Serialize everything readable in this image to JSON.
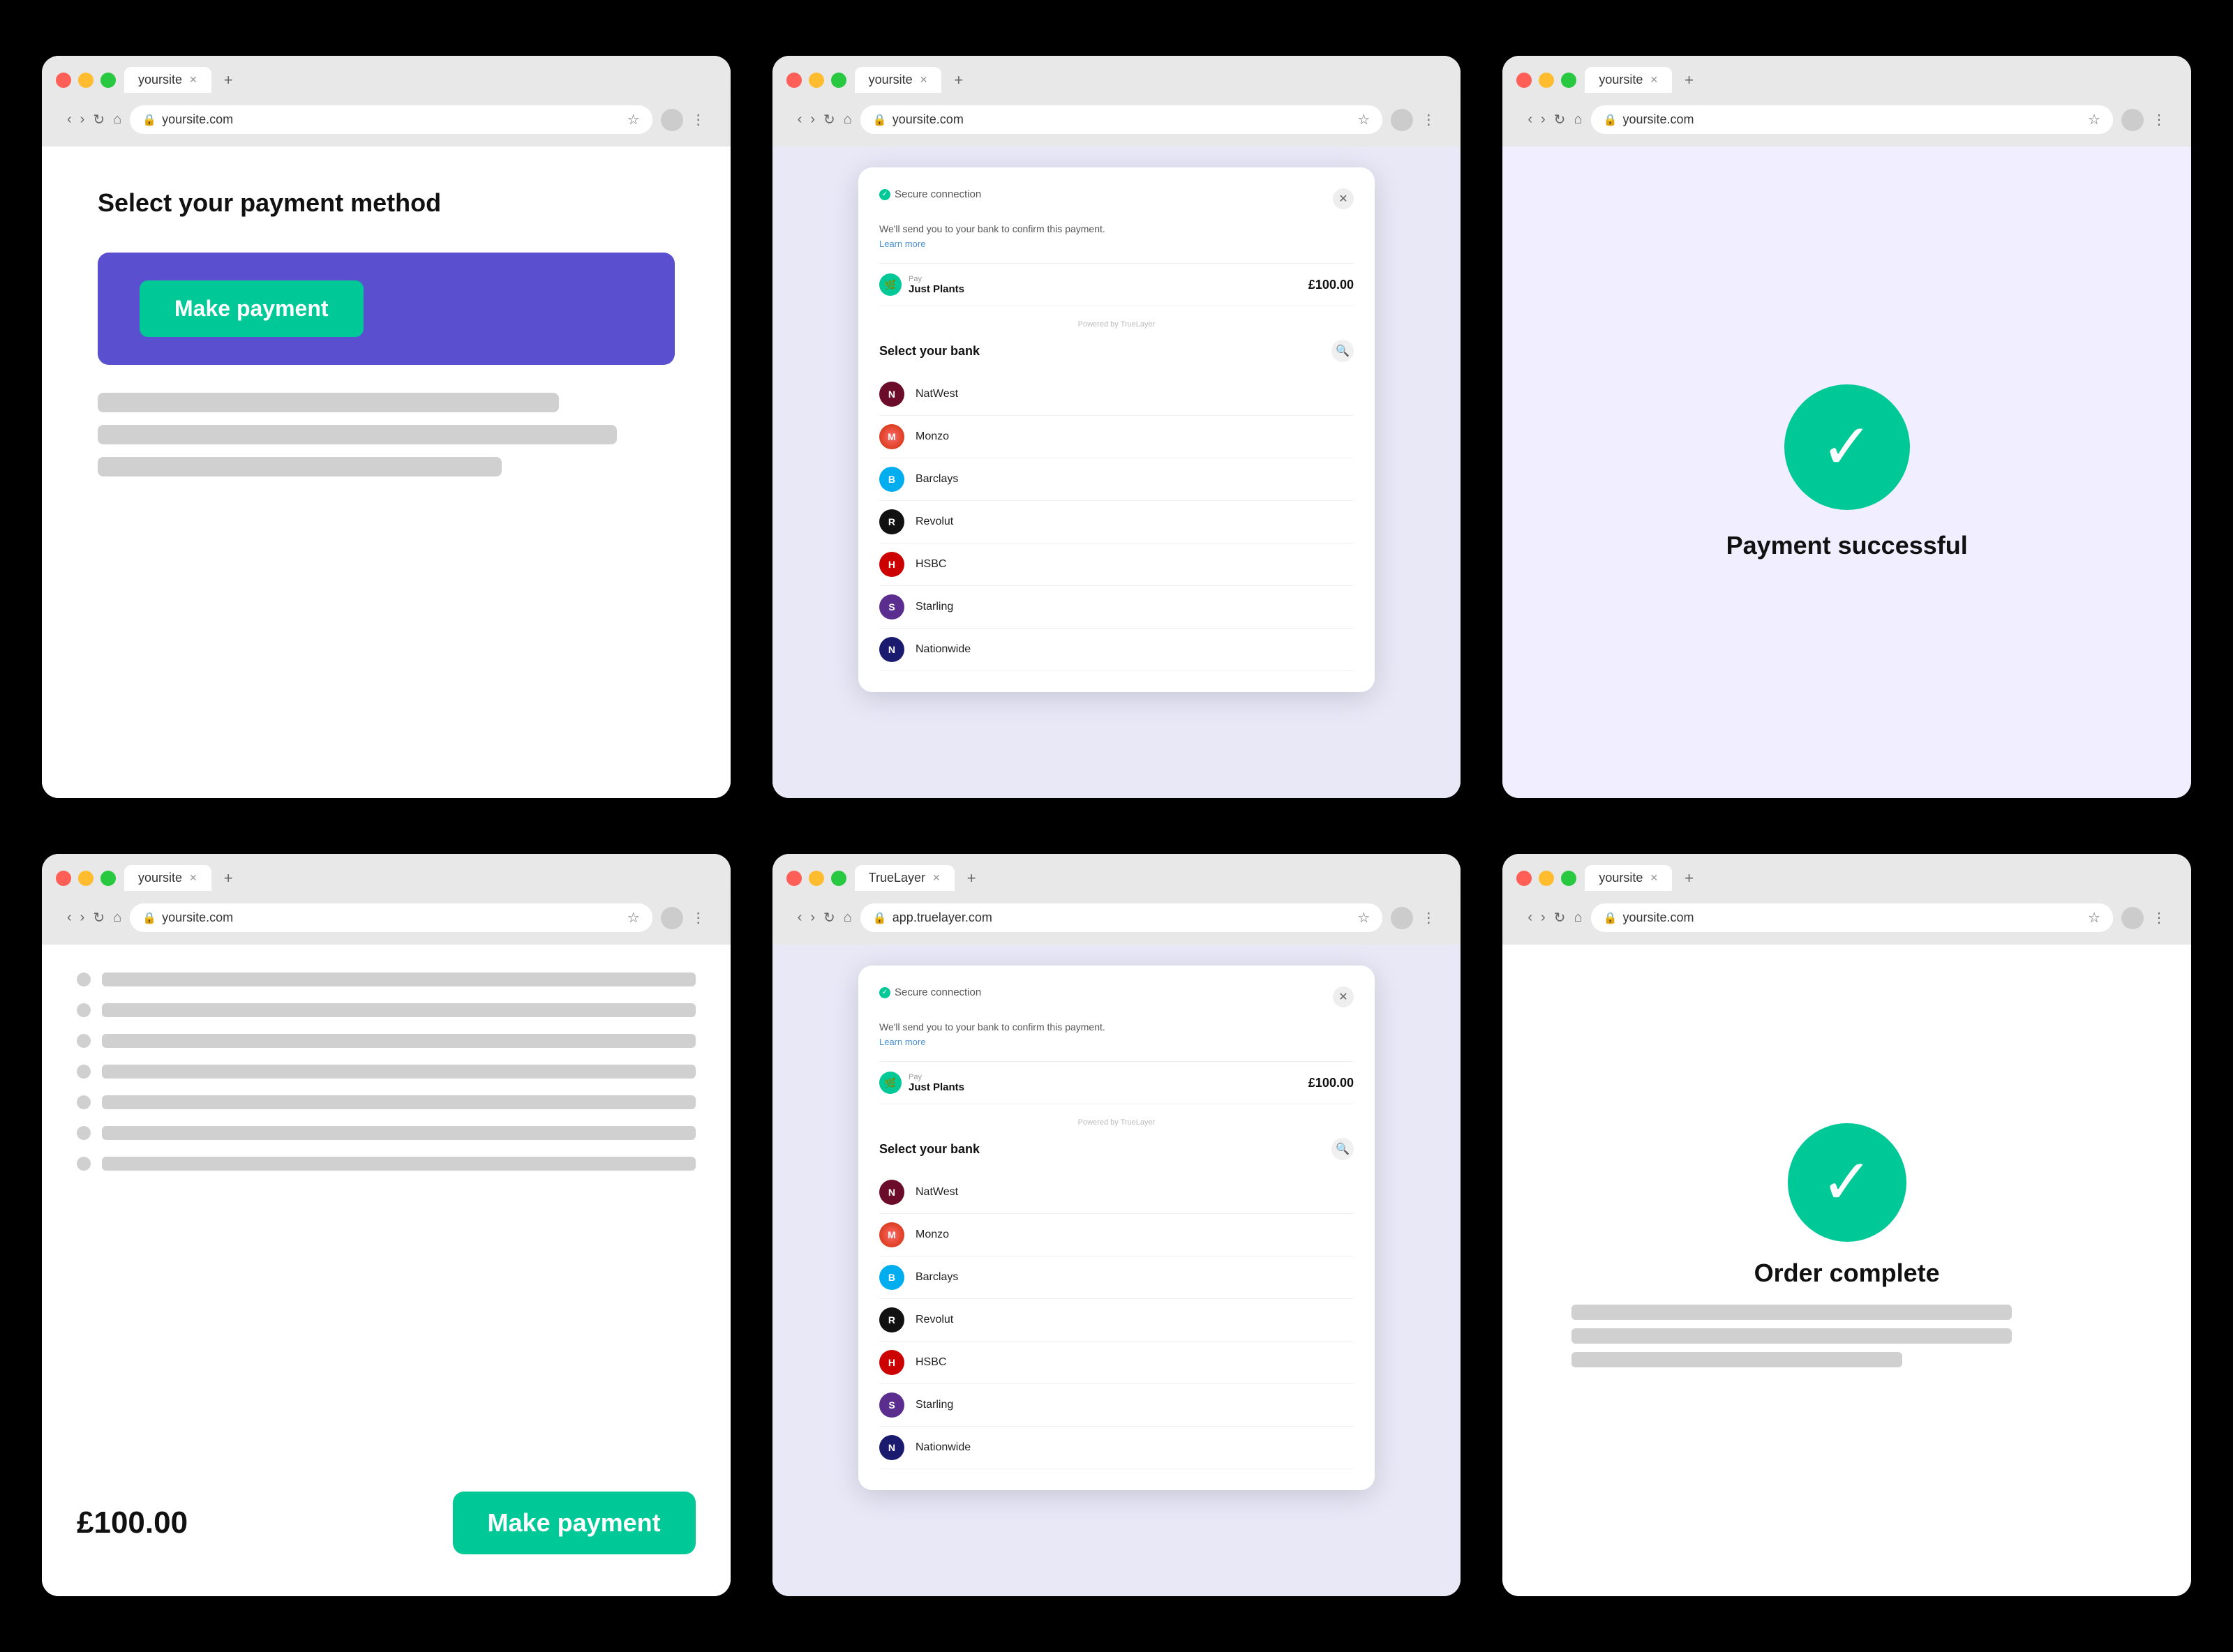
{
  "panels": [
    {
      "id": "panel-1",
      "tab": "yoursite",
      "url": "yoursite.com",
      "type": "payment-method",
      "title": "Select your payment method",
      "button_label": "Make payment",
      "button_bg": "#5a4fcf",
      "button_color": "#00c896"
    },
    {
      "id": "panel-2",
      "tab": "yoursite",
      "url": "yoursite.com",
      "type": "bank-select",
      "modal": {
        "secure_label": "Secure connection",
        "description": "We'll send you to your bank to confirm this payment.",
        "learn_more": "Learn more",
        "pay_label": "Pay",
        "pay_name": "Just Plants",
        "pay_amount": "£100.00",
        "powered_by": "Powered by TrueLayer",
        "bank_search_label": "Select your bank",
        "banks": [
          {
            "name": "NatWest",
            "logo_class": "logo-natwest",
            "initial": "N"
          },
          {
            "name": "Monzo",
            "logo_class": "logo-monzo",
            "initial": "M"
          },
          {
            "name": "Barclays",
            "logo_class": "logo-barclays",
            "initial": "B"
          },
          {
            "name": "Revolut",
            "logo_class": "logo-revolut",
            "initial": "R"
          },
          {
            "name": "HSBC",
            "logo_class": "logo-hsbc",
            "initial": "H"
          },
          {
            "name": "Starling",
            "logo_class": "logo-starling",
            "initial": "S"
          },
          {
            "name": "Nationwide",
            "logo_class": "logo-nationwide",
            "initial": "N"
          }
        ]
      }
    },
    {
      "id": "panel-3",
      "tab": "yoursite",
      "url": "yoursite.com",
      "type": "payment-success",
      "success_text": "Payment successful"
    },
    {
      "id": "panel-4",
      "tab": "yoursite",
      "url": "yoursite.com",
      "type": "checkout",
      "amount": "£100.00",
      "button_label": "Make payment"
    },
    {
      "id": "panel-5",
      "tab": "TrueLayer",
      "url": "app.truelayer.com",
      "type": "bank-select",
      "modal": {
        "secure_label": "Secure connection",
        "description": "We'll send you to your bank to confirm this payment.",
        "learn_more": "Learn more",
        "pay_label": "Pay",
        "pay_name": "Just Plants",
        "pay_amount": "£100.00",
        "powered_by": "Powered by TrueLayer",
        "bank_search_label": "Select your bank",
        "banks": [
          {
            "name": "NatWest",
            "logo_class": "logo-natwest",
            "initial": "N"
          },
          {
            "name": "Monzo",
            "logo_class": "logo-monzo",
            "initial": "M"
          },
          {
            "name": "Barclays",
            "logo_class": "logo-barclays",
            "initial": "B"
          },
          {
            "name": "Revolut",
            "logo_class": "logo-revolut",
            "initial": "R"
          },
          {
            "name": "HSBC",
            "logo_class": "logo-hsbc",
            "initial": "H"
          },
          {
            "name": "Starling",
            "logo_class": "logo-starling",
            "initial": "S"
          },
          {
            "name": "Nationwide",
            "logo_class": "logo-nationwide",
            "initial": "N"
          }
        ]
      }
    },
    {
      "id": "panel-6",
      "tab": "yoursite",
      "url": "yoursite.com",
      "type": "order-complete",
      "success_text": "Order complete"
    }
  ]
}
